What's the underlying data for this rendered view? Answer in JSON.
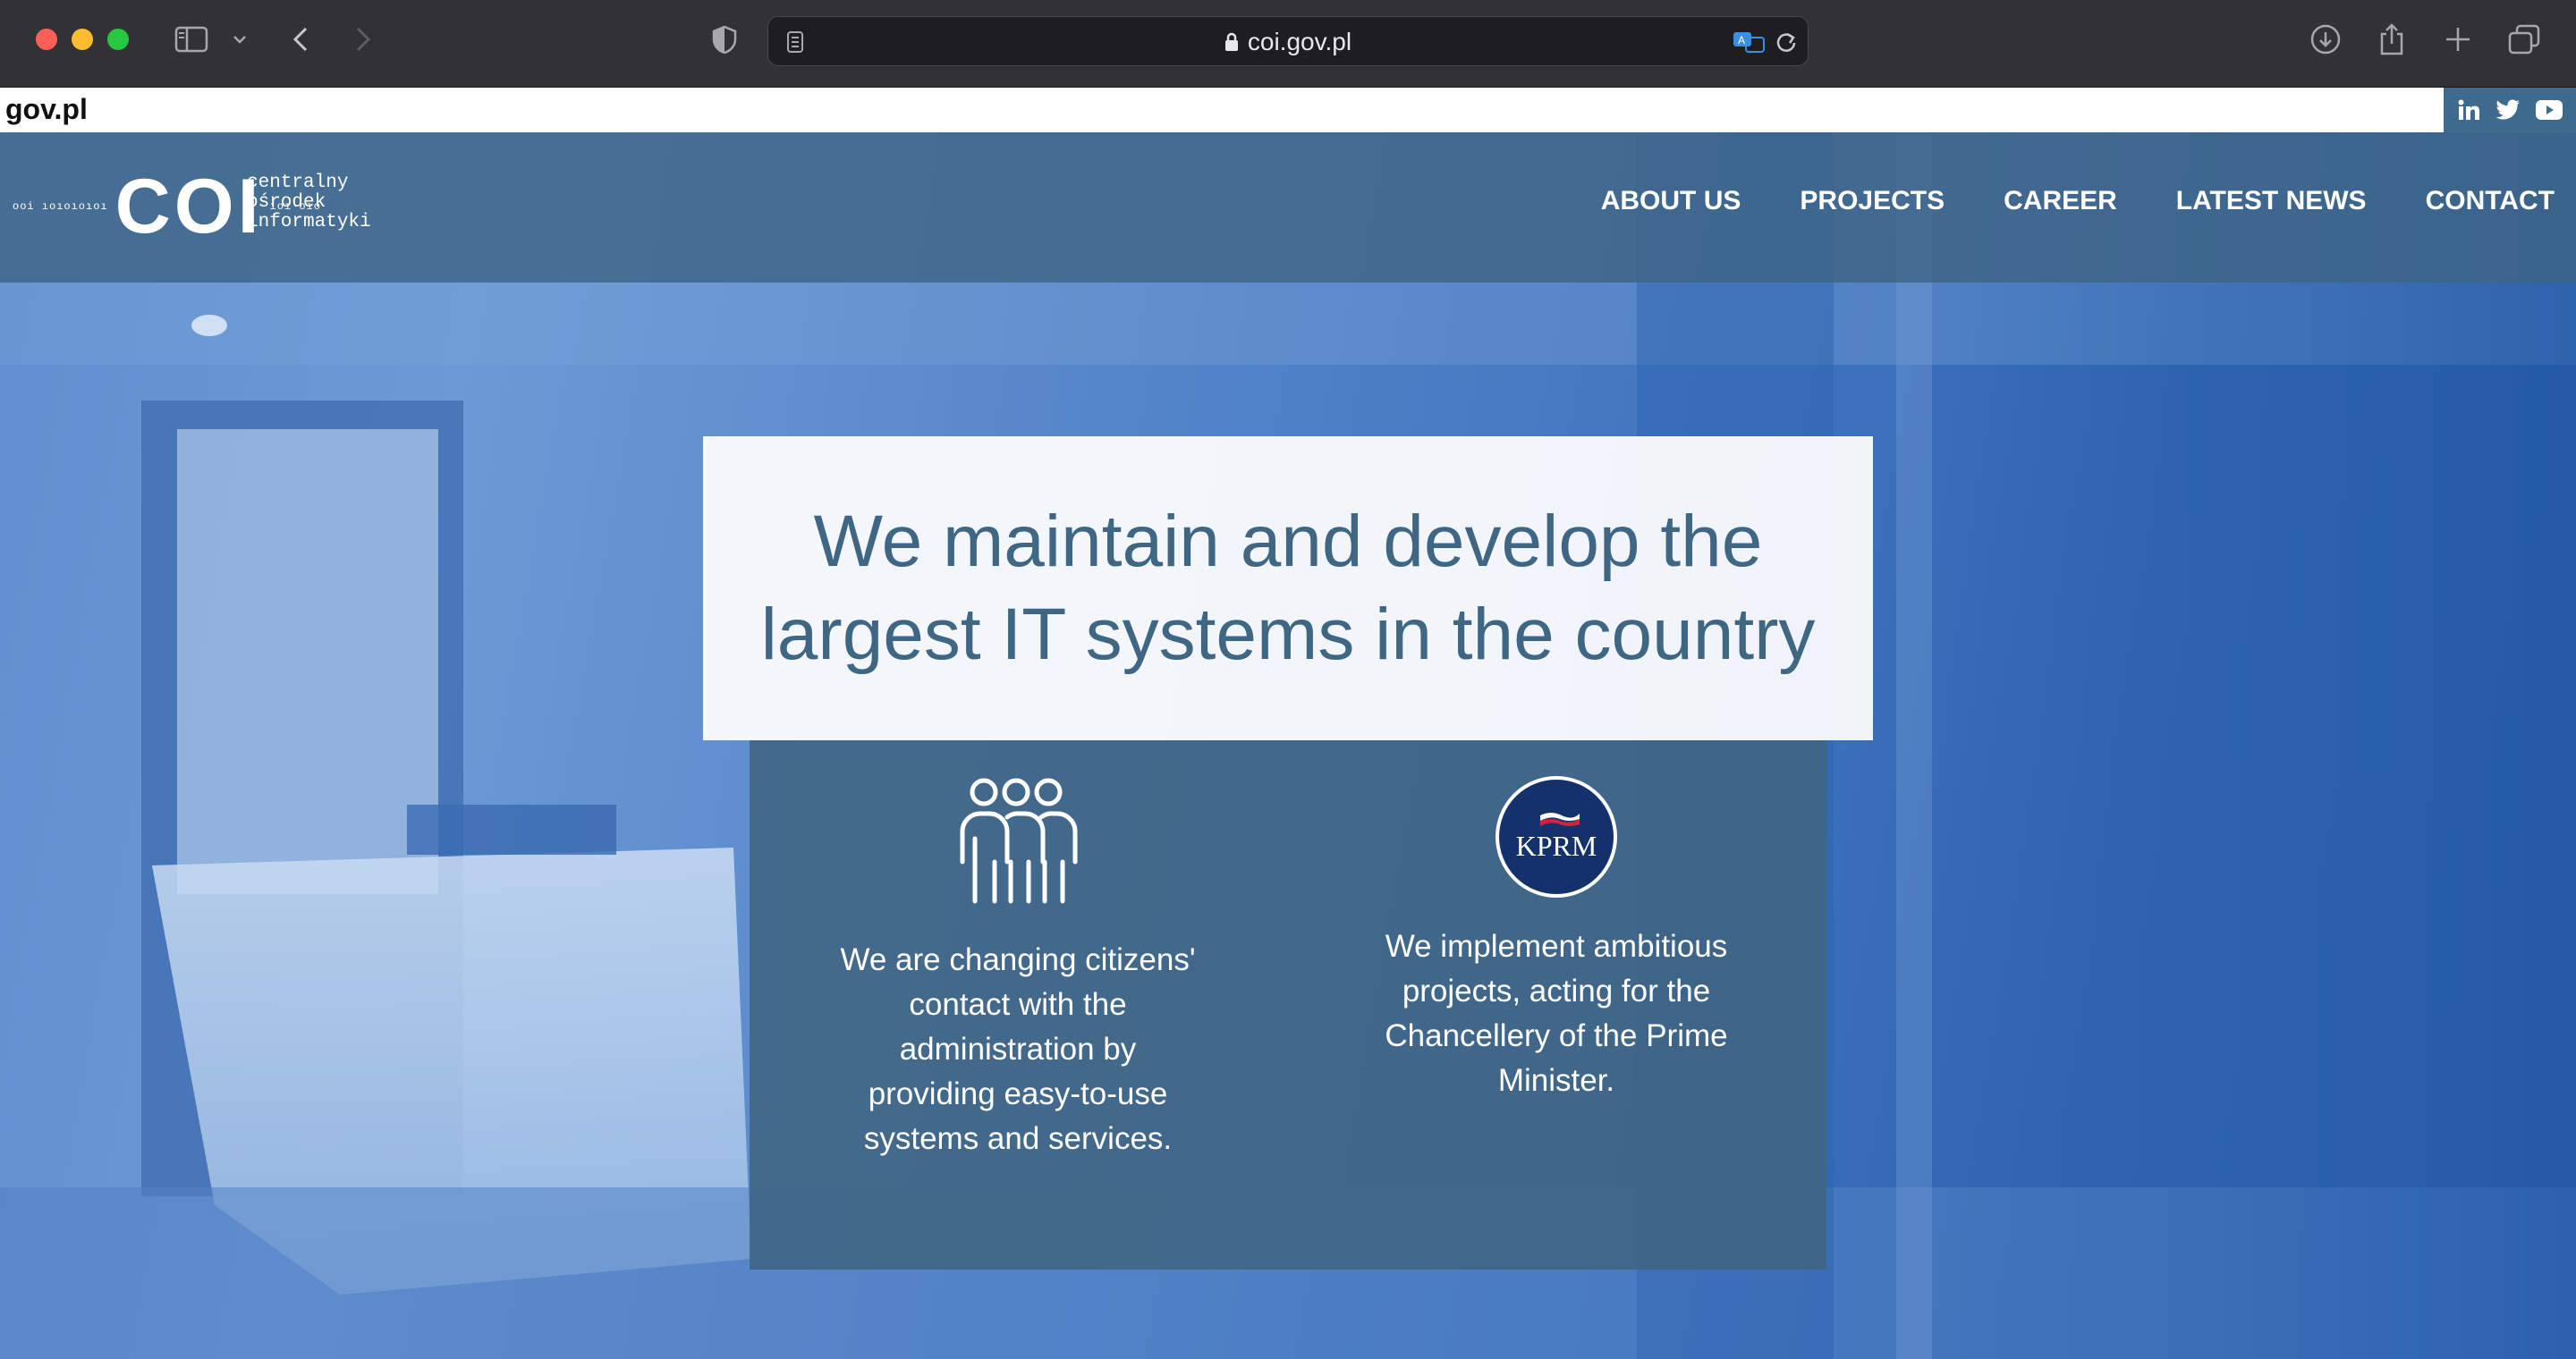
{
  "browser": {
    "url": "coi.gov.pl"
  },
  "govbar": {
    "label": "gov.pl"
  },
  "header": {
    "logo_text": "COI",
    "logo_dots_left": "ooi ıoıoıoıoı",
    "logo_dots_right": "ıoı oıo",
    "logo_subtitle": [
      "centralny",
      "ośrodek",
      "informatyki"
    ],
    "nav": [
      "ABOUT US",
      "PROJECTS",
      "CAREER",
      "LATEST NEWS",
      "CONTACT"
    ]
  },
  "hero": {
    "title_line1": "We maintain and develop the",
    "title_line2": "largest IT systems in the country"
  },
  "features": [
    {
      "icon": "people-icon",
      "lines": [
        "We are changing citizens'",
        "contact with the",
        "administration by",
        "providing easy-to-use",
        "systems and services."
      ]
    },
    {
      "icon": "kprm-logo",
      "badge": "KPRM",
      "lines": [
        "We implement ambitious",
        "projects, acting for the",
        "Chancellery of the Prime",
        "Minister."
      ]
    }
  ],
  "colors": {
    "navbar": "#3e6485",
    "hero_text": "#3f6683",
    "panel": "#406482",
    "kprm_blue": "#14316b"
  }
}
